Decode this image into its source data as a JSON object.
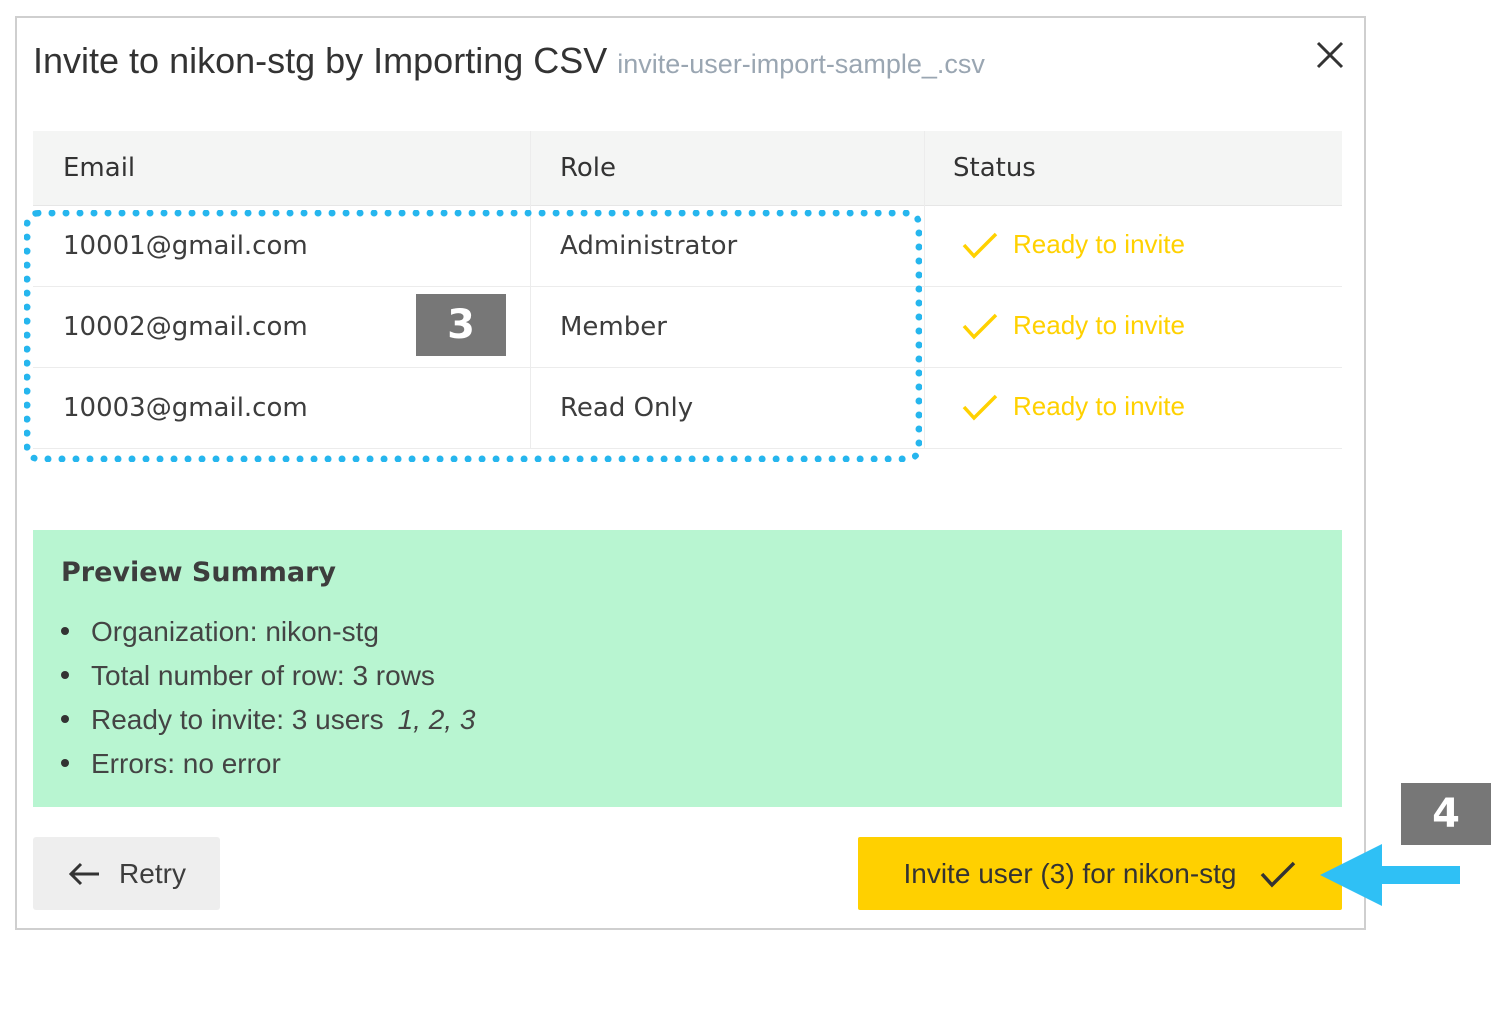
{
  "dialog": {
    "title": "Invite to nikon-stg by Importing CSV",
    "filename": "invite-user-import-sample_.csv"
  },
  "table": {
    "headers": [
      "Email",
      "Role",
      "Status"
    ],
    "rows": [
      {
        "email": "10001@gmail.com",
        "role": "Administrator",
        "status": "Ready to invite"
      },
      {
        "email": "10002@gmail.com",
        "role": "Member",
        "status": "Ready to invite"
      },
      {
        "email": "10003@gmail.com",
        "role": "Read Only",
        "status": "Ready to invite"
      }
    ]
  },
  "summary": {
    "title": "Preview Summary",
    "items": [
      {
        "text": "Organization: nikon-stg",
        "extra": ""
      },
      {
        "text": "Total number of row: 3 rows",
        "extra": ""
      },
      {
        "text": "Ready to invite: 3 users",
        "extra": "1, 2, 3"
      },
      {
        "text": "Errors: no error",
        "extra": ""
      }
    ]
  },
  "buttons": {
    "retry": "Retry",
    "invite": "Invite user (3) for nikon-stg"
  },
  "annotations": {
    "badge_3": "3",
    "badge_4": "4"
  },
  "colors": {
    "status": "#ffd100",
    "invite_button": "#ffd000",
    "summary_bg": "#b8f5d1",
    "highlight": "#26b6ee",
    "badge": "#777777"
  },
  "icons": [
    "close-icon",
    "check-icon",
    "arrow-left-icon",
    "pointer-arrow-icon"
  ]
}
